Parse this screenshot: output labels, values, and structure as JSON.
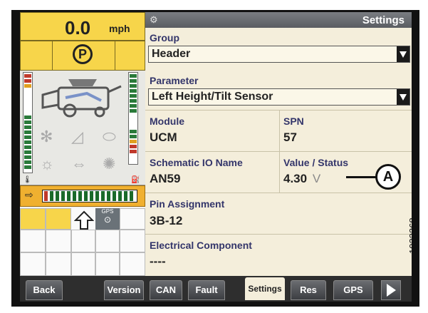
{
  "status": {
    "speed_value": "0.0",
    "speed_unit": "mph",
    "park_symbol": "P",
    "gps_label": "GPS"
  },
  "header": {
    "title": "Settings",
    "icon": "wrench-icon"
  },
  "settings": {
    "group": {
      "label": "Group",
      "value": "Header"
    },
    "parameter": {
      "label": "Parameter",
      "value": "Left Height/Tilt Sensor"
    },
    "module": {
      "label": "Module",
      "value": "UCM"
    },
    "spn": {
      "label": "SPN",
      "value": "57"
    },
    "schematic_io": {
      "label": "Schematic IO Name",
      "value": "AN59"
    },
    "value_status": {
      "label": "Value / Status",
      "value": "4.30",
      "unit": "V"
    },
    "pin_assignment": {
      "label": "Pin Assignment",
      "value": "3B-12"
    },
    "electrical_component": {
      "label": "Electrical Component",
      "value": "----"
    }
  },
  "tabs": [
    {
      "label": "Back"
    },
    {
      "label": "Version"
    },
    {
      "label": "CAN"
    },
    {
      "label": "Fault"
    },
    {
      "label": "Settings",
      "active": true
    },
    {
      "label": "Res"
    },
    {
      "label": "GPS"
    }
  ],
  "callout": {
    "label": "A"
  },
  "figure_id": "1023268",
  "colors": {
    "status_yellow": "#f7d54a",
    "panel_bg": "#f4eedb",
    "label_blue": "#33356a",
    "title_bar": "#6a6d72"
  }
}
